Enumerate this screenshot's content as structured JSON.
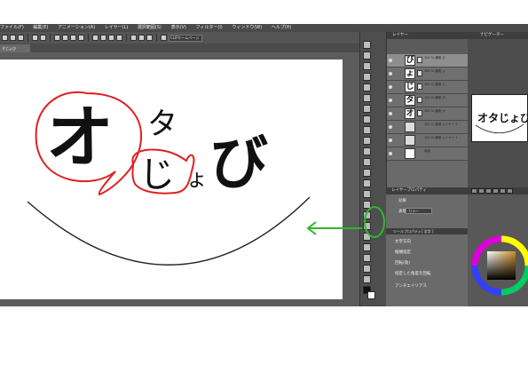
{
  "menu": [
    "ファイル(F)",
    "編集(E)",
    "アニメーション(A)",
    "レイヤー(L)",
    "選択範囲(S)",
    "表示(V)",
    "フィルター(I)",
    "ウィンドウ(W)",
    "ヘルプ(H)"
  ],
  "toolbar": {
    "home_label": "CLIPホームページ"
  },
  "document_tab": {
    "label": "オじょび"
  },
  "canvas": {
    "char_1": "オ",
    "char_2": "タ",
    "char_3": "じ",
    "char_4": "ょ",
    "char_5": "び"
  },
  "annotations": {
    "circle_color": "#e02020",
    "arrow_color": "#2db82d"
  },
  "layer_panel": {
    "title": "レイヤー",
    "layers": [
      {
        "glyph": "び",
        "meta": "100 % 通常\nび"
      },
      {
        "glyph": "ょ",
        "meta": "100 % 通常\nょ"
      },
      {
        "glyph": "じ",
        "meta": "100 % 通常\nじ"
      },
      {
        "glyph": "タ",
        "meta": "100 % 通常\nタ"
      },
      {
        "glyph": "オ",
        "meta": "100 % 通常\nオ"
      },
      {
        "glyph": "",
        "meta": "100 % 通常\nレイヤー 2"
      },
      {
        "glyph": "",
        "meta": "100 % 通常\nレイヤー 1"
      },
      {
        "glyph": "",
        "meta": "用紙"
      }
    ]
  },
  "property_panel": {
    "title": "レイヤープロパティ",
    "effect_label": "効果",
    "color_label": "表現色",
    "color_value": "カラー"
  },
  "tool_property": {
    "title": "ツールプロパティ[ 文字 ]",
    "direction_label": "文字方向",
    "vertical_label": "縦横指定",
    "rotate_label": "回転(角)",
    "rotate_option": "指定した角度を回転",
    "anti_alias_label": "アンチエイリアス"
  },
  "navigator": {
    "title": "ナビゲーター",
    "preview_text": "オタじょび"
  },
  "colors": {
    "app_bg": "#5a5a5a",
    "panel_bg": "#6a6a6a",
    "title_bar": "#3d3d3d",
    "annotation_red": "#e02020",
    "annotation_green": "#2db82d"
  }
}
